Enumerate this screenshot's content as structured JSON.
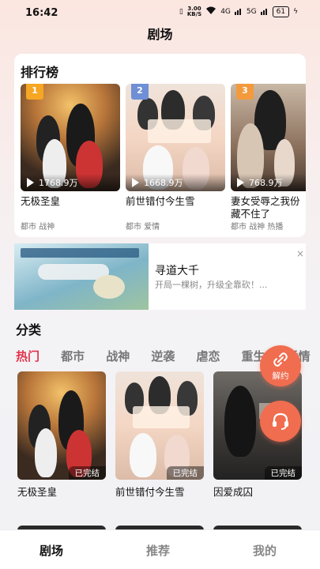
{
  "status_bar": {
    "time": "16:42",
    "speed_top": "3.00",
    "speed_bottom": "KB/S",
    "signal1": "4G",
    "signal2": "5G",
    "battery": "61"
  },
  "header": {
    "title": "剧场"
  },
  "ranking": {
    "title": "排行榜",
    "items": [
      {
        "rank": "1",
        "badge_color": "#f5a623",
        "views": "1768.9万",
        "name": "无极圣皇",
        "tags": "都市 战神"
      },
      {
        "rank": "2",
        "badge_color": "#6f8fd6",
        "views": "1668.9万",
        "name": "前世错付今生雪",
        "tags": "都市 爱情"
      },
      {
        "rank": "3",
        "badge_color": "#f39a3c",
        "views": "768.9万",
        "name": "妻女受辱之我份藏不住了",
        "tags": "都市 战神 热播"
      }
    ]
  },
  "ad": {
    "title": "寻道大千",
    "subtitle": "开局一棵树，升级全靠砍！...",
    "close": "×"
  },
  "category": {
    "title": "分类",
    "tabs": [
      "热门",
      "都市",
      "战神",
      "逆袭",
      "虐恋",
      "重生",
      "爱情"
    ],
    "active_tab": "热门"
  },
  "grid": [
    {
      "name": "无极圣皇",
      "status": "已完结"
    },
    {
      "name": "前世错付今生雪",
      "status": "已完结"
    },
    {
      "name": "因爱成囚",
      "status": "已完结"
    }
  ],
  "floating": {
    "unlock_label": "解约"
  },
  "tabbar": {
    "items": [
      "剧场",
      "推荐",
      "我的"
    ]
  },
  "colors": {
    "accent": "#e1344c",
    "fab": "#f06d4f"
  }
}
